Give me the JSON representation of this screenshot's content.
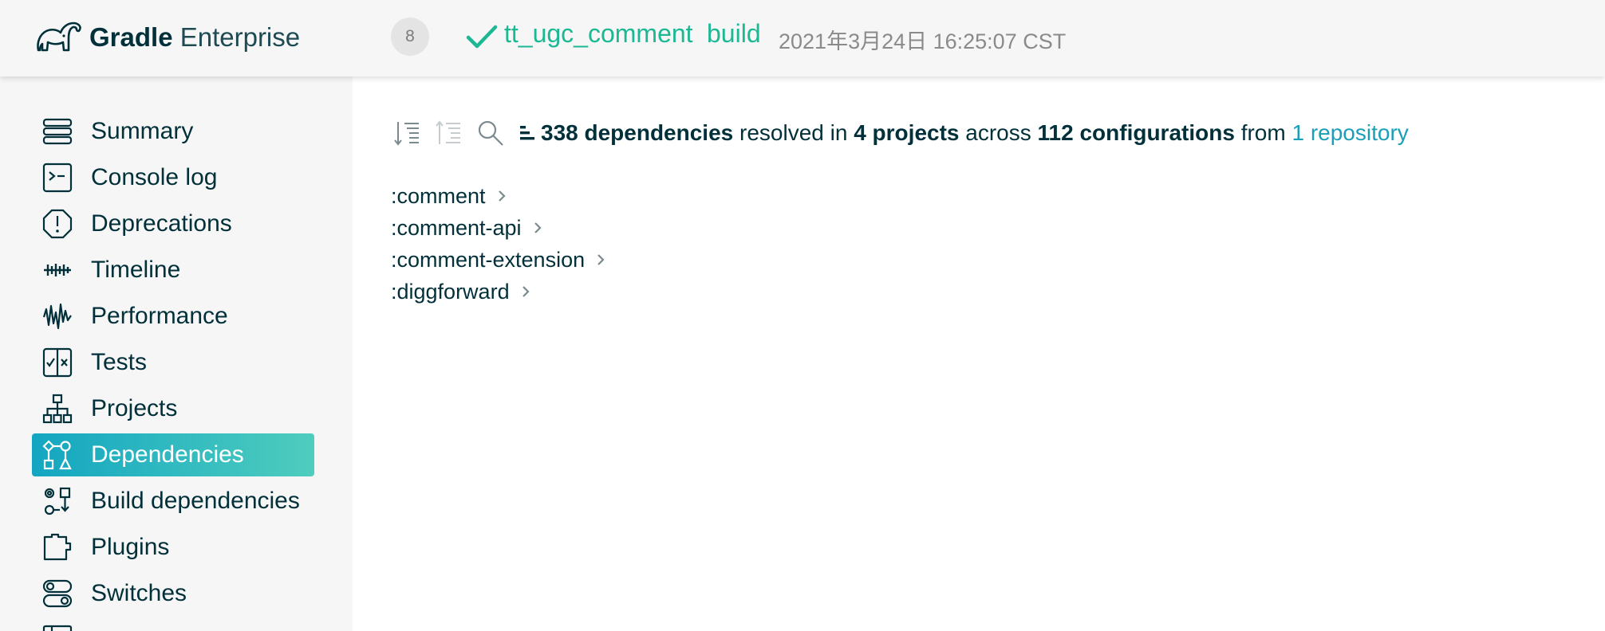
{
  "header": {
    "brand_bold": "Gradle",
    "brand_light": "Enterprise",
    "build_number": "8",
    "project_name": "tt_ugc_comment",
    "task_name": "build",
    "timestamp": "2021年3月24日 16:25:07 CST",
    "status_color": "#1bb893"
  },
  "sidebar": {
    "active_gradient": [
      "#13a6c1",
      "#4fcdbe"
    ],
    "items": [
      {
        "label": "Summary",
        "icon": "summary-icon"
      },
      {
        "label": "Console log",
        "icon": "console-log-icon"
      },
      {
        "label": "Deprecations",
        "icon": "deprecations-icon"
      },
      {
        "label": "Timeline",
        "icon": "timeline-icon"
      },
      {
        "label": "Performance",
        "icon": "performance-icon"
      },
      {
        "label": "Tests",
        "icon": "tests-icon"
      },
      {
        "label": "Projects",
        "icon": "projects-icon"
      },
      {
        "label": "Dependencies",
        "icon": "dependencies-icon",
        "active": true
      },
      {
        "label": "Build dependencies",
        "icon": "build-dependencies-icon"
      },
      {
        "label": "Plugins",
        "icon": "plugins-icon"
      },
      {
        "label": "Switches",
        "icon": "switches-icon"
      }
    ]
  },
  "main": {
    "summary": {
      "dep_count": "338 dependencies",
      "text_resolved_in": "resolved in",
      "project_count": "4 projects",
      "text_across": "across",
      "config_count": "112 configurations",
      "text_from": "from",
      "repo_link": "1 repository"
    },
    "projects": [
      ":comment",
      ":comment-api",
      ":comment-extension",
      ":diggforward"
    ]
  }
}
